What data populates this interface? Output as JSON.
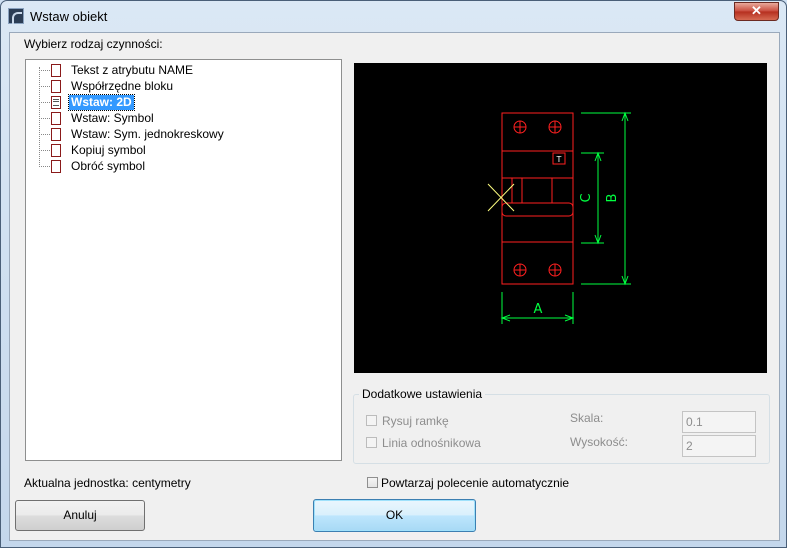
{
  "window": {
    "title": "Wstaw obiekt",
    "close_glyph": "✕"
  },
  "action_label": "Wybierz rodzaj czynności:",
  "tree": {
    "items": [
      {
        "label": "Tekst z atrybutu NAME",
        "selected": false
      },
      {
        "label": "Współrzędne bloku",
        "selected": false
      },
      {
        "label": "Wstaw: 2D",
        "selected": true
      },
      {
        "label": "Wstaw: Symbol",
        "selected": false
      },
      {
        "label": "Wstaw: Sym. jednokreskowy",
        "selected": false
      },
      {
        "label": "Kopiuj symbol",
        "selected": false
      },
      {
        "label": "Obróć symbol",
        "selected": false
      }
    ]
  },
  "preview": {
    "dim_a": "A",
    "dim_b": "B",
    "dim_c": "C",
    "tag": "T",
    "colors": {
      "background": "#000000",
      "outline": "#ff2020",
      "dimension": "#00ff40",
      "text": "#ffffff",
      "marker": "#ffff80"
    }
  },
  "extra_settings": {
    "title": "Dodatkowe ustawienia",
    "draw_frame": {
      "label": "Rysuj ramkę",
      "checked": false,
      "enabled": false
    },
    "leader_line": {
      "label": "Linia odnośnikowa",
      "checked": false,
      "enabled": false
    },
    "scale": {
      "label": "Skala:",
      "value": "0.1"
    },
    "height": {
      "label": "Wysokość:",
      "value": "2"
    }
  },
  "current_unit": "Aktualna jednostka: centymetry",
  "repeat_auto": {
    "label": "Powtarzaj polecenie automatycznie",
    "checked": false
  },
  "buttons": {
    "cancel": "Anuluj",
    "ok": "OK"
  }
}
